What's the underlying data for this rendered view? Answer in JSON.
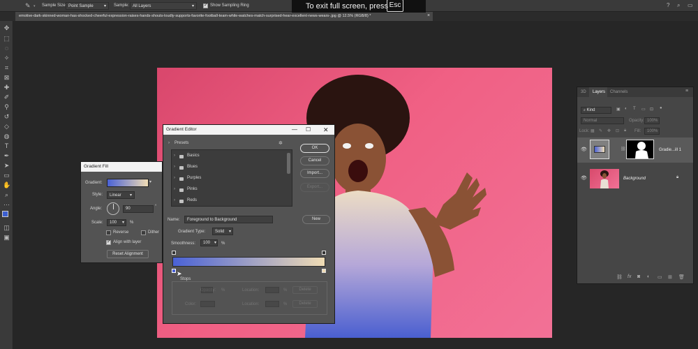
{
  "options_bar": {
    "sample_size_label": "Sample Size:",
    "sample_size_value": "Point Sample",
    "sample_label": "Sample:",
    "sample_value": "All Layers",
    "show_ring_label": "Show Sampling Ring"
  },
  "fullscreen_banner": {
    "text": "To exit full screen, press",
    "key": "Esc"
  },
  "document_tab": {
    "title": "emotive-dark-skinned-woman-has-shocked-cheerful-expression-raises-hands-shouts-loudly-supports-favorite-football-team-while-watches-match-surprised-hear-excellent-news-wears-.jpg @ 12.5% (RGB/8) *",
    "close": "×"
  },
  "gradient_fill": {
    "title": "Gradient Fill",
    "gradient_label": "Gradient:",
    "style_label": "Style:",
    "style_value": "Linear",
    "angle_label": "Angle:",
    "angle_value": "90",
    "scale_label": "Scale:",
    "scale_value": "100",
    "percent": "%",
    "reverse_label": "Reverse",
    "dither_label": "Dither",
    "align_label": "Align with layer",
    "reset_label": "Reset Alignment",
    "reverse_checked": false,
    "dither_checked": false,
    "align_checked": true
  },
  "gradient_editor": {
    "title": "Gradient Editor",
    "presets_label": "Presets",
    "presets": [
      "Basics",
      "Blues",
      "Purples",
      "Pinks",
      "Reds"
    ],
    "ok_label": "OK",
    "cancel_label": "Cancel",
    "import_label": "Import...",
    "export_label": "Export...",
    "name_label": "Name:",
    "name_value": "Foreground to Background",
    "new_label": "New",
    "gradient_type_label": "Gradient Type:",
    "gradient_type_value": "Solid",
    "smoothness_label": "Smoothness:",
    "smoothness_value": "100",
    "percent": "%",
    "stops_label": "Stops",
    "opacity_label": "Opacity:",
    "color_label": "Color:",
    "location_label": "Location:",
    "delete_label": "Delete",
    "gradient_start_color": "#4a62d6",
    "gradient_end_color": "#f0dcb4"
  },
  "layers_panel": {
    "tabs": [
      "3D",
      "Layers",
      "Channels"
    ],
    "active_tab": "Layers",
    "filter_kind": "Kind",
    "blend_mode": "Normal",
    "opacity_label": "Opacity:",
    "opacity_value": "100%",
    "lock_label": "Lock:",
    "fill_label": "Fill:",
    "fill_value": "100%",
    "layers": [
      {
        "name": "Gradie...ill 1"
      },
      {
        "name": "Background"
      }
    ]
  },
  "colors": {
    "foreground": "#3c5fd1",
    "background": "#f0dcb4",
    "accent": "#4a62d6"
  }
}
